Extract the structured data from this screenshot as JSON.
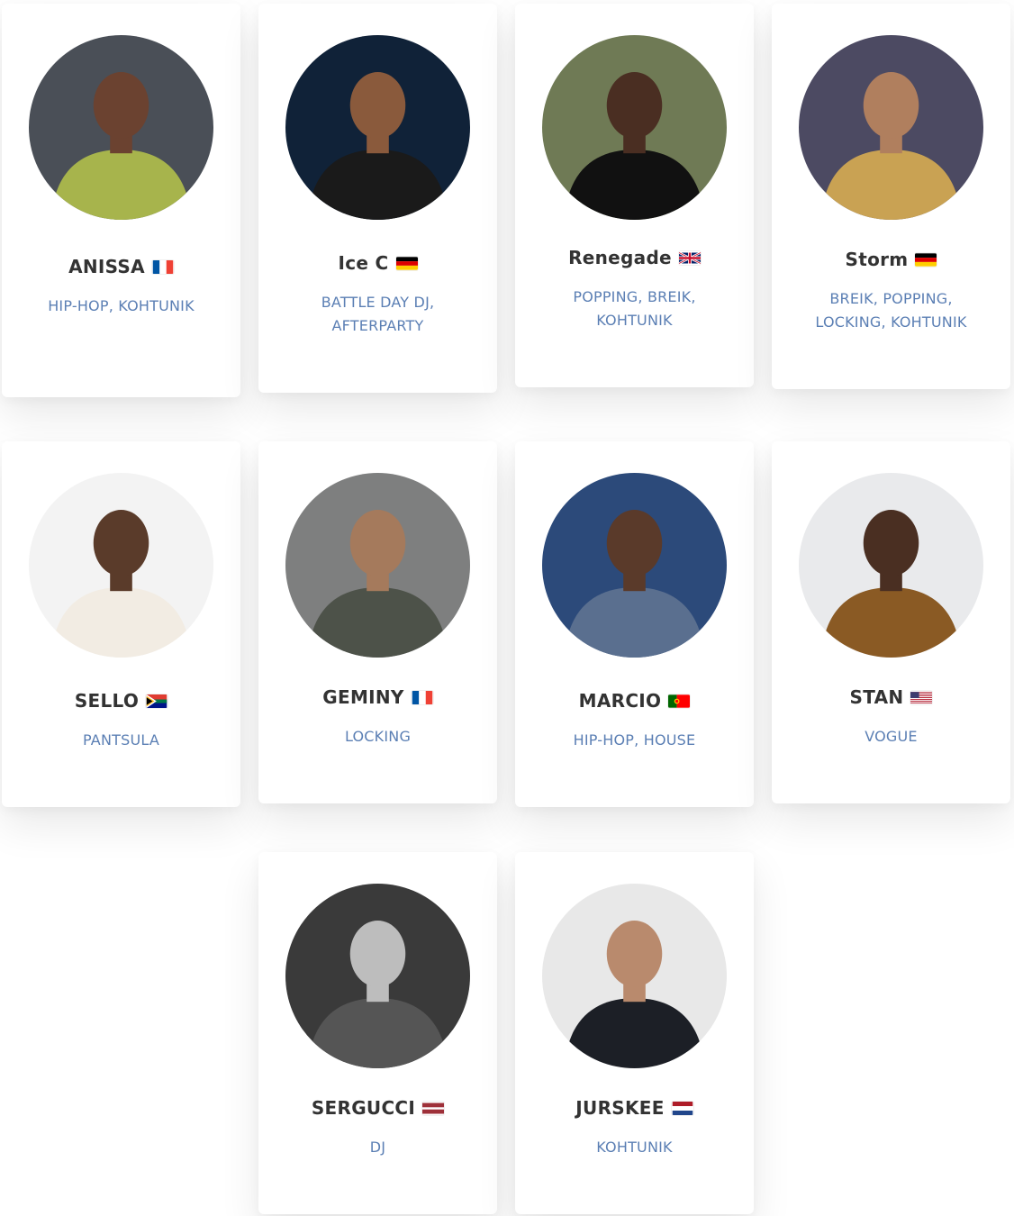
{
  "artists": [
    {
      "name": "ANISSA",
      "flag": "france-flag",
      "styles": "HIP-HOP, KOHTUNIK",
      "photo_bg": "#4a4f57",
      "photo_shirt": "#a7b44c",
      "photo_skin": "#6b4230"
    },
    {
      "name": "Ice C",
      "flag": "germany-flag",
      "styles": "BATTLE DAY DJ, AFTERPARTY",
      "photo_bg": "#102238",
      "photo_shirt": "#1a1a1a",
      "photo_skin": "#8a5a3c"
    },
    {
      "name": "Renegade",
      "flag": "uk-flag",
      "styles": "POPPING, BREIK, KOHTUNIK",
      "photo_bg": "#6f7a55",
      "photo_shirt": "#111111",
      "photo_skin": "#4a2e22"
    },
    {
      "name": "Storm",
      "flag": "germany-flag",
      "styles": "BREIK, POPPING, LOCKING, KOHTUNIK",
      "photo_bg": "#4c4a62",
      "photo_shirt": "#c9a253",
      "photo_skin": "#b07f5e"
    },
    {
      "name": "SELLO",
      "flag": "south-africa-flag",
      "styles": "PANTSULA",
      "photo_bg": "#f3f3f3",
      "photo_shirt": "#f2ece3",
      "photo_skin": "#5a3b2a"
    },
    {
      "name": "GEMINY",
      "flag": "france-flag",
      "styles": "LOCKING",
      "photo_bg": "#7e7f7f",
      "photo_shirt": "#4d5249",
      "photo_skin": "#a57a5c"
    },
    {
      "name": "MARCIO",
      "flag": "portugal-flag",
      "styles": "HIP-HOP, HOUSE",
      "photo_bg": "#2c4a7a",
      "photo_shirt": "#5a6f8f",
      "photo_skin": "#5a3a2a"
    },
    {
      "name": "STAN",
      "flag": "usa-flag",
      "styles": "VOGUE",
      "photo_bg": "#e9eaec",
      "photo_shirt": "#8a5a24",
      "photo_skin": "#4a2f22"
    },
    {
      "name": "SERGUCCI",
      "flag": "latvia-flag",
      "styles": "DJ",
      "photo_bg": "#3a3a3a",
      "photo_shirt": "#555555",
      "photo_skin": "#bdbdbd"
    },
    {
      "name": "JURSKEE",
      "flag": "netherlands-flag",
      "styles": "KOHTUNIK",
      "photo_bg": "#e8e8e8",
      "photo_shirt": "#1c1f26",
      "photo_skin": "#b98a6d"
    }
  ]
}
